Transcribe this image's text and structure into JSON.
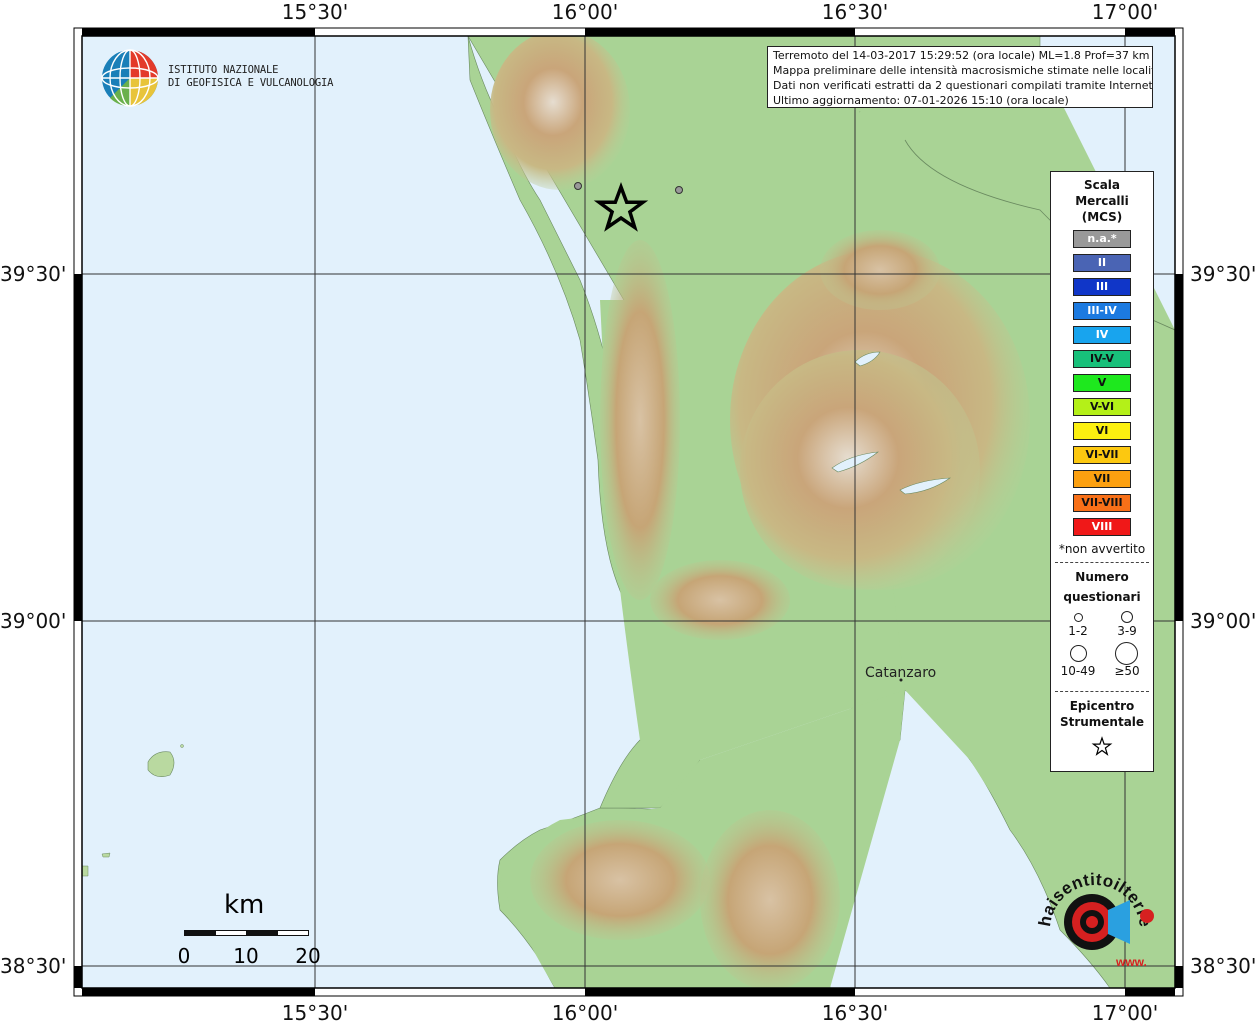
{
  "coords": {
    "top": [
      "15°30'",
      "16°00'",
      "16°30'",
      "17°00'"
    ],
    "bottom": [
      "15°30'",
      "16°00'",
      "16°30'",
      "17°00'"
    ],
    "left": [
      "39°30'",
      "39°00'",
      "38°30'"
    ],
    "right": [
      "39°30'",
      "39°00'",
      "38°30'"
    ]
  },
  "logo_ingv": {
    "line1": "ISTITUTO NAZIONALE",
    "line2": "DI GEOFISICA E VULCANOLOGIA"
  },
  "info": {
    "line1": "Terremoto del 14-03-2017 15:29:52 (ora locale) ML=1.8 Prof=37 km",
    "line2": "Mappa preliminare delle intensità macrosismiche stimate nelle località",
    "line3": "Dati non verificati estratti da 2 questionari compilati tramite Internet.",
    "line4": "Ultimo aggiornamento: 07-01-2026 15:10 (ora locale)"
  },
  "legend": {
    "title1": "Scala",
    "title2": "Mercalli",
    "title3": "(MCS)",
    "scale": [
      {
        "label": "n.a.*",
        "color": "#999999",
        "text": "#ffffff"
      },
      {
        "label": "II",
        "color": "#4a64b4",
        "text": "#ffffff"
      },
      {
        "label": "III",
        "color": "#1036c8",
        "text": "#ffffff"
      },
      {
        "label": "III-IV",
        "color": "#1c7ae0",
        "text": "#ffffff"
      },
      {
        "label": "IV",
        "color": "#18a4ee",
        "text": "#ffffff"
      },
      {
        "label": "IV-V",
        "color": "#18c07a",
        "text": "#111111"
      },
      {
        "label": "V",
        "color": "#1ee81e",
        "text": "#111111"
      },
      {
        "label": "V-VI",
        "color": "#b4f018",
        "text": "#111111"
      },
      {
        "label": "VI",
        "color": "#fcf010",
        "text": "#111111"
      },
      {
        "label": "VI-VII",
        "color": "#fcc810",
        "text": "#111111"
      },
      {
        "label": "VII",
        "color": "#fca010",
        "text": "#111111"
      },
      {
        "label": "VII-VIII",
        "color": "#f87018",
        "text": "#111111"
      },
      {
        "label": "VIII",
        "color": "#f01818",
        "text": "#ffffff"
      }
    ],
    "na_note": "*non avvertito",
    "count_title1": "Numero",
    "count_title2": "questionari",
    "count_labels": [
      "1-2",
      "3-9",
      "10-49",
      "≥50"
    ],
    "epi_title1": "Epicentro",
    "epi_title2": "Strumentale"
  },
  "scalebar": {
    "unit": "km",
    "ticks": [
      "0",
      "10",
      "20"
    ]
  },
  "places": {
    "catanzaro": "Catanzaro"
  },
  "logo_hst": {
    "text": "haisentitoilterremoto.it",
    "www": "www."
  },
  "colors": {
    "sea": "#e2f1fc",
    "lowland": "#aed49a",
    "hills": "#c8c08a",
    "mountains": "#b89060",
    "peaks": "#e8e0d4",
    "frame": "#000000"
  }
}
